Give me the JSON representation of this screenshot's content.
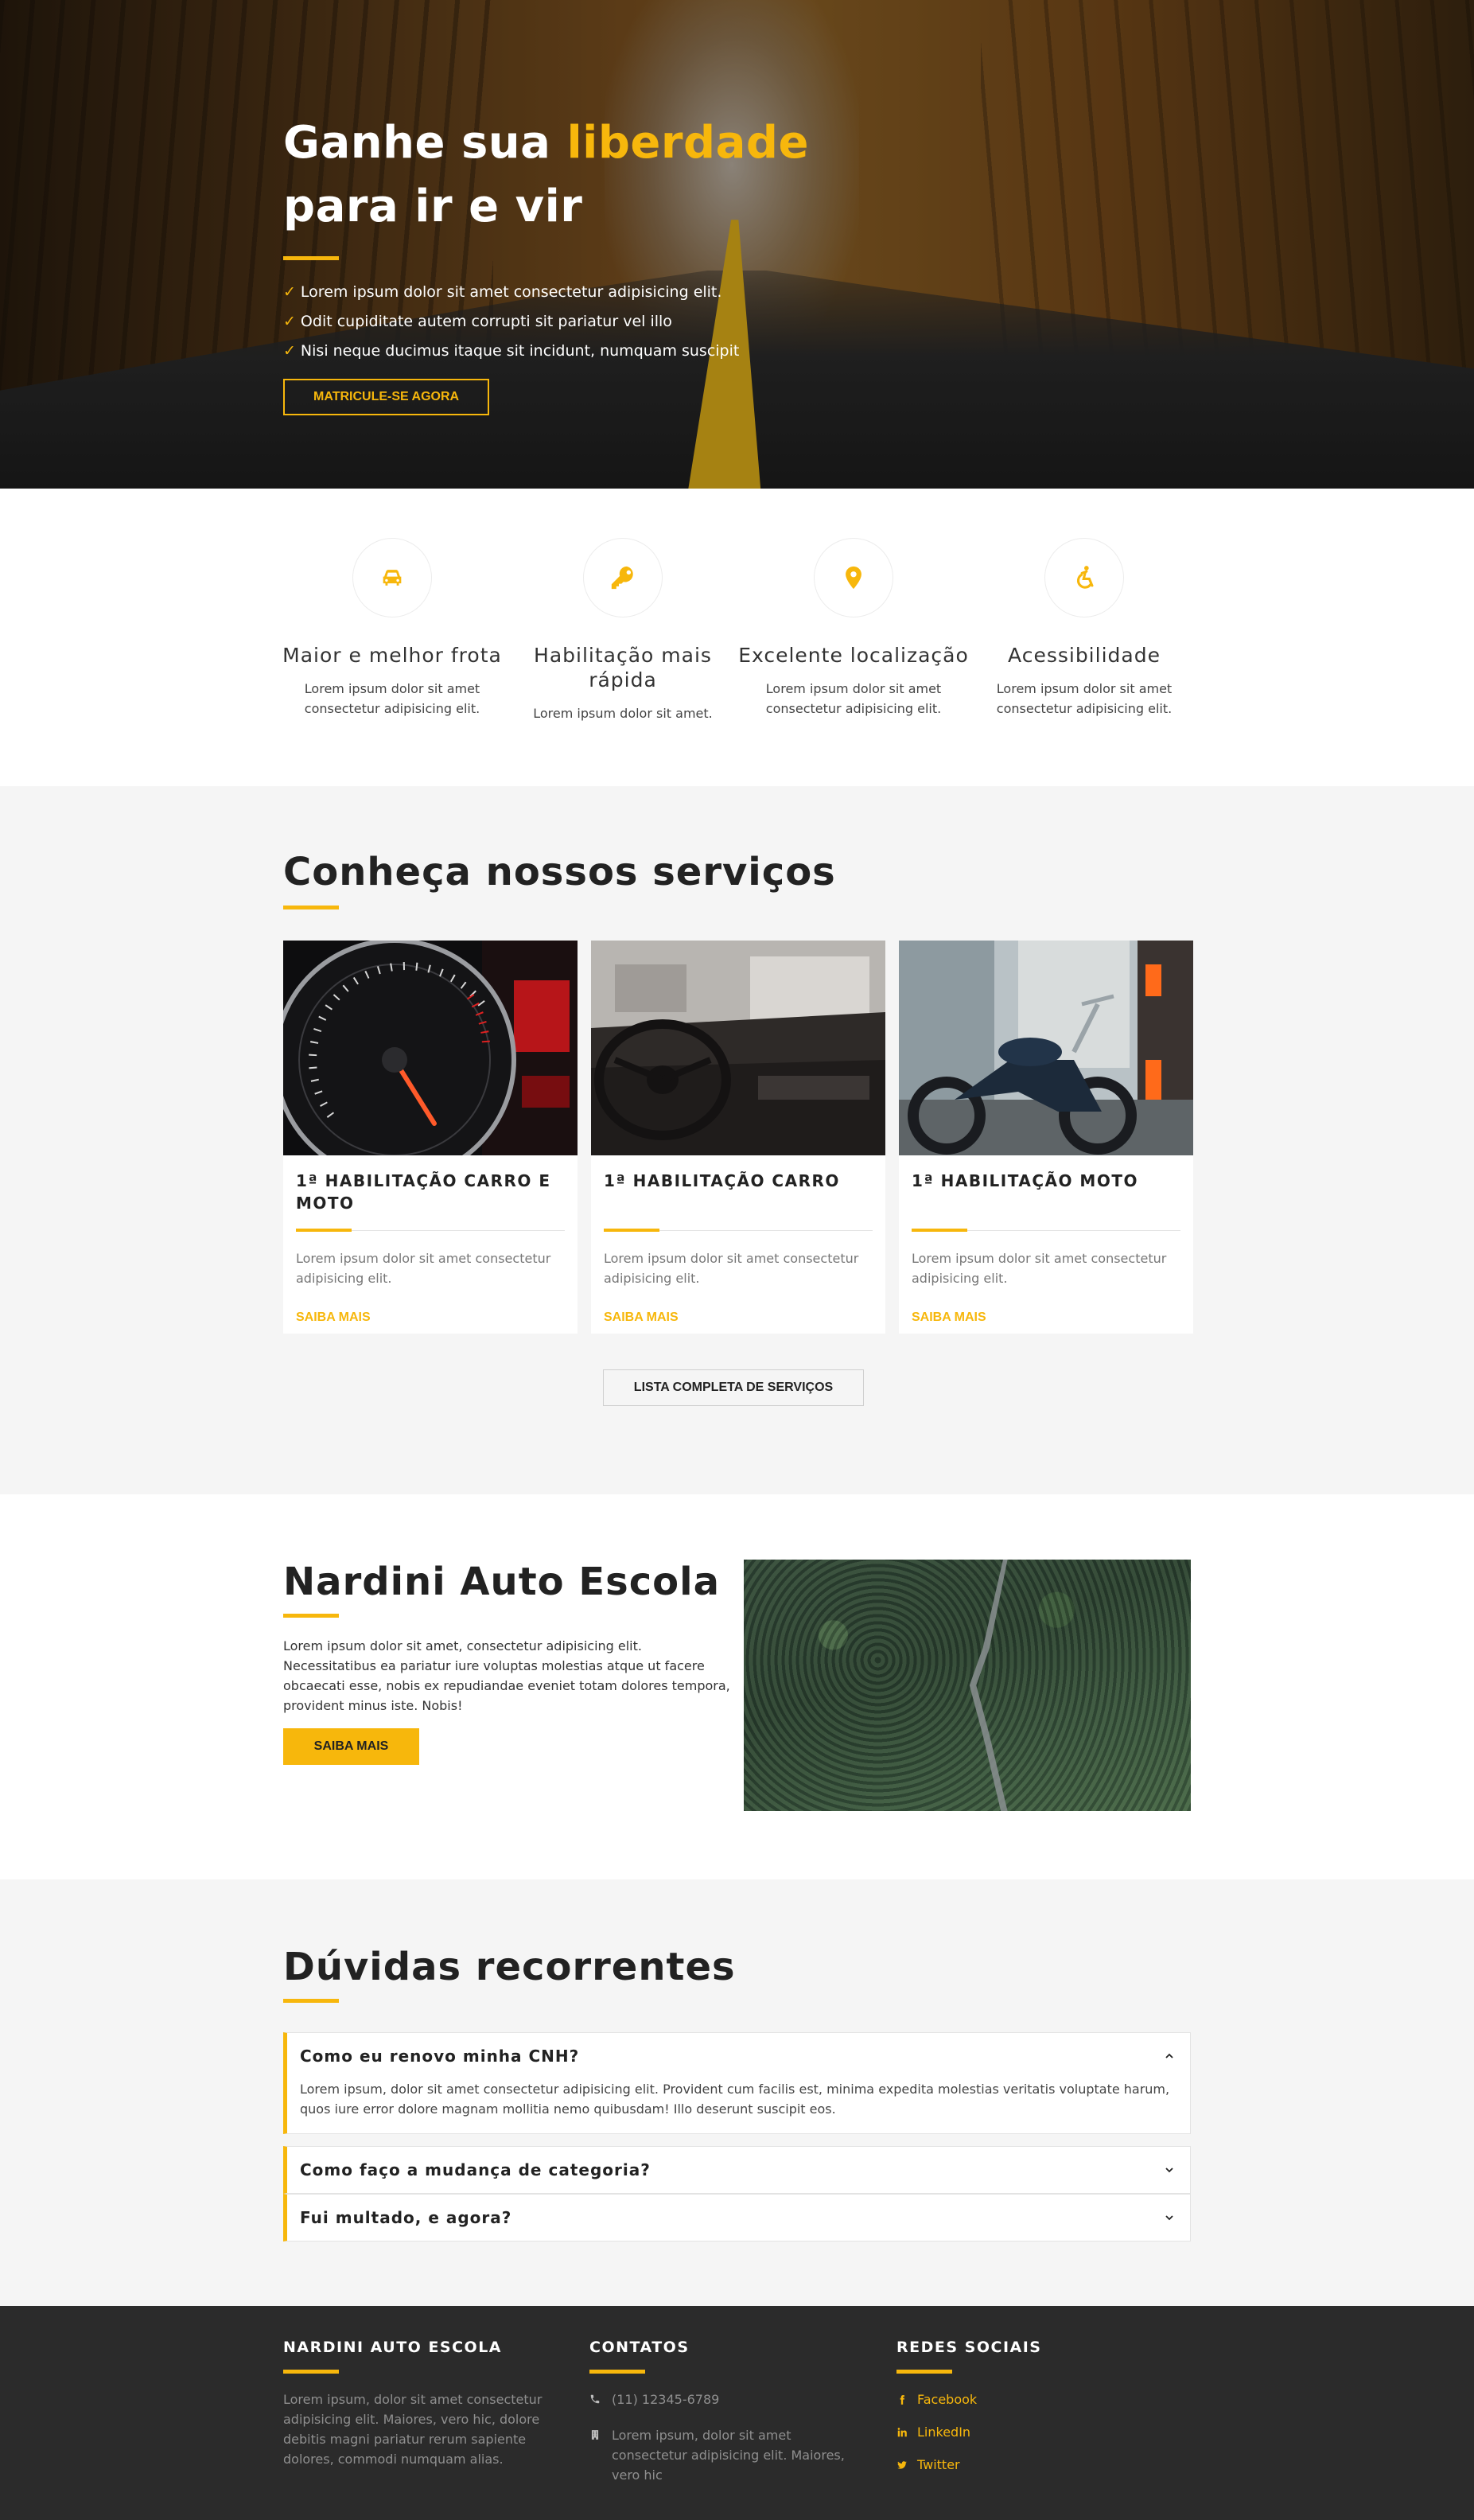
{
  "hero": {
    "title_pre": "Ganhe sua ",
    "title_accent": "liberdade",
    "title_line2": "para ir e vir",
    "bullets": [
      "Lorem ipsum dolor sit amet consectetur adipisicing elit.",
      "Odit cupiditate autem corrupti sit pariatur vel illo",
      "Nisi neque ducimus itaque sit incidunt, numquam suscipit"
    ],
    "cta": "MATRICULE-SE AGORA"
  },
  "features": [
    {
      "icon": "car-icon",
      "title": "Maior e melhor frota",
      "text": "Lorem ipsum dolor sit amet consectetur adipisicing elit."
    },
    {
      "icon": "key-icon",
      "title": "Habilitação mais rápida",
      "text": "Lorem ipsum dolor sit amet."
    },
    {
      "icon": "map-pin-icon",
      "title": "Excelente localização",
      "text": "Lorem ipsum dolor sit amet consectetur adipisicing elit."
    },
    {
      "icon": "accessibility-icon",
      "title": "Acessibilidade",
      "text": "Lorem ipsum dolor sit amet consectetur adipisicing elit."
    }
  ],
  "services": {
    "title": "Conheça nossos serviços",
    "cards": [
      {
        "title": "1ª HABILITAÇÃO CARRO E MOTO",
        "text": "Lorem ipsum dolor sit amet consectetur adipisicing elit.",
        "link": "SAIBA MAIS",
        "image": "speedometer-photo"
      },
      {
        "title": "1ª HABILITAÇÃO CARRO",
        "text": "Lorem ipsum dolor sit amet consectetur adipisicing elit.",
        "link": "SAIBA MAIS",
        "image": "car-interior-photo"
      },
      {
        "title": "1ª HABILITAÇÃO MOTO",
        "text": "Lorem ipsum dolor sit amet consectetur adipisicing elit.",
        "link": "SAIBA MAIS",
        "image": "motorcycle-photo"
      }
    ],
    "list_button": "LISTA COMPLETA DE SERVIÇOS"
  },
  "about": {
    "title": "Nardini Auto Escola",
    "text": "Lorem ipsum dolor sit amet, consectetur adipisicing elit. Necessitatibus ea pariatur iure voluptas molestias atque ut facere obcaecati esse, nobis ex repudiandae eveniet totam dolores tempora, provident minus iste. Nobis!",
    "button": "SAIBA MAIS"
  },
  "faq": {
    "title": "Dúvidas recorrentes",
    "items": [
      {
        "question": "Como eu renovo minha CNH?",
        "answer": "Lorem ipsum, dolor sit amet consectetur adipisicing elit. Provident cum facilis est, minima expedita molestias veritatis voluptate harum, quos iure error dolore magnam mollitia nemo quibusdam! Illo deserunt suscipit eos.",
        "open": true
      },
      {
        "question": "Como faço a mudança de categoria?",
        "answer": "",
        "open": false
      },
      {
        "question": "Fui multado, e agora?",
        "answer": "",
        "open": false
      }
    ]
  },
  "footer": {
    "about": {
      "title": "NARDINI AUTO ESCOLA",
      "text": "Lorem ipsum, dolor sit amet consectetur adipisicing elit. Maiores, vero hic, dolore debitis magni pariatur rerum sapiente dolores, commodi numquam alias."
    },
    "contacts": {
      "title": "CONTATOS",
      "phone": "(11) 12345-6789",
      "address": "Lorem ipsum, dolor sit amet consectetur adipisicing elit. Maiores, vero hic"
    },
    "social": {
      "title": "REDES SOCIAIS",
      "links": [
        "Facebook",
        "LinkedIn",
        "Twitter"
      ]
    }
  },
  "colors": {
    "accent": "#f7b70c",
    "dark": "#2b2b2b",
    "light_bg": "#f5f5f5"
  }
}
